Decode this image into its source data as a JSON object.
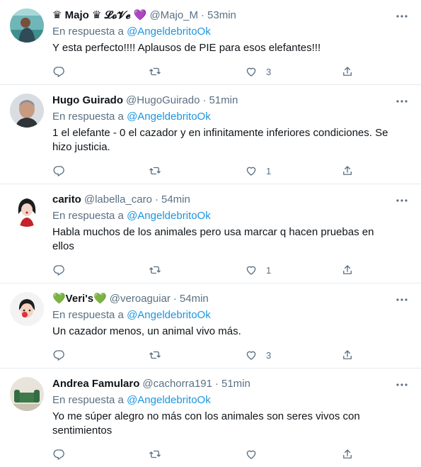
{
  "reply_prefix": "En respuesta a",
  "tweets": [
    {
      "name_prefix": "♛ Majo ♛ 𝓛𝓸𝓥𝓮",
      "name_emoji": "💜",
      "handle": "@Majo_M",
      "time": "53min",
      "reply_to": "@AngeldebritoOk",
      "text": "Y esta perfecto!!!! Aplausos de PIE para esos elefantes!!!",
      "likes": "3"
    },
    {
      "name_prefix": "Hugo Guirado",
      "name_emoji": "",
      "handle": "@HugoGuirado",
      "time": "51min",
      "reply_to": "@AngeldebritoOk",
      "text": "1 el elefante - 0 el cazador y en infinitamente inferiores condiciones. Se hizo justicia.",
      "likes": "1"
    },
    {
      "name_prefix": "carito",
      "name_emoji": "",
      "handle": "@labella_caro",
      "time": "54min",
      "reply_to": "@AngeldebritoOk",
      "text": "Habla muchos de los animales pero usa marcar q hacen pruebas en ellos",
      "likes": "1"
    },
    {
      "name_prefix": "💚Veri's💚",
      "name_emoji": "",
      "handle": "@veroaguiar",
      "time": "54min",
      "reply_to": "@AngeldebritoOk",
      "text": "Un cazador menos, un animal vivo más.",
      "likes": "3"
    },
    {
      "name_prefix": "Andrea Famularo",
      "name_emoji": "",
      "handle": "@cachorra191",
      "time": "51min",
      "reply_to": "@AngeldebritoOk",
      "text": "Yo me súper alegro no más con los animales son seres vivos con sentimientos",
      "likes": ""
    }
  ],
  "icons": {
    "reply": "reply-icon",
    "retweet": "retweet-icon",
    "like": "heart-icon",
    "share": "share-icon",
    "more": "more-icon"
  },
  "colors": {
    "link": "#1b95e0",
    "secondary": "#5b7083",
    "divider": "#e6ecf0"
  }
}
